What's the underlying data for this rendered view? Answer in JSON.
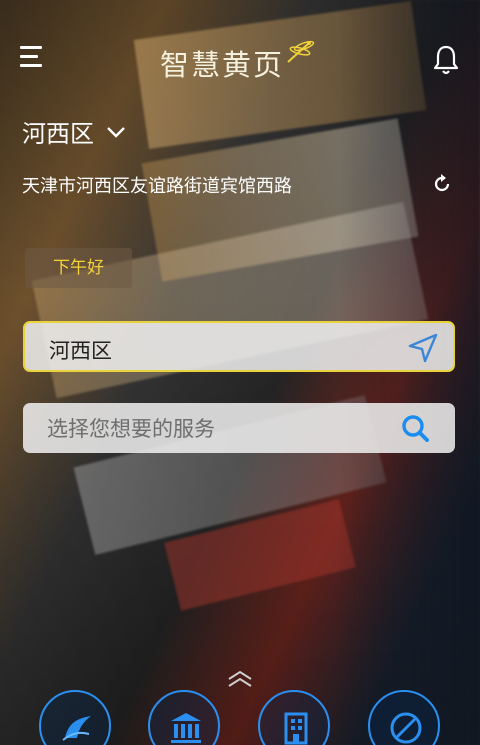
{
  "header": {
    "logo_text": "智慧黄页"
  },
  "location": {
    "district": "河西区",
    "address": "天津市河西区友谊路街道宾馆西路"
  },
  "greeting": "下午好",
  "location_field": {
    "value": "河西区"
  },
  "search": {
    "placeholder": "选择您想要的服务"
  },
  "colors": {
    "accent_yellow": "#e8d43a",
    "icon_blue": "#2a8ff0",
    "greeting_text": "#f5d23a"
  },
  "bottom_icons": [
    "ribbon-logo-icon",
    "bank-icon",
    "building-icon",
    "no-entry-icon"
  ]
}
